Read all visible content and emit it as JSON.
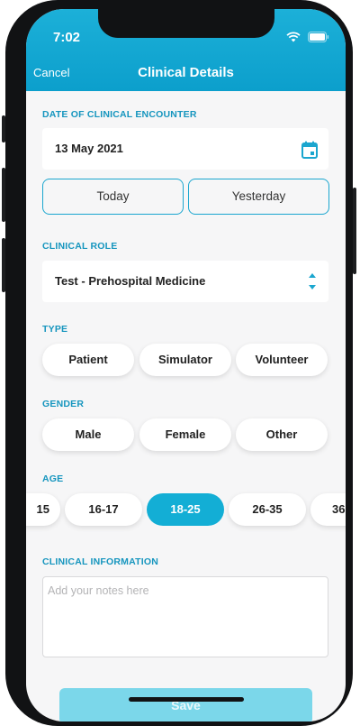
{
  "status_bar": {
    "time": "7:02"
  },
  "header": {
    "cancel_label": "Cancel",
    "title": "Clinical Details"
  },
  "encounter": {
    "label": "DATE OF CLINICAL ENCOUNTER",
    "date": "13 May 2021",
    "today_label": "Today",
    "yesterday_label": "Yesterday"
  },
  "role": {
    "label": "CLINICAL ROLE",
    "value": "Test - Prehospital Medicine"
  },
  "type": {
    "label": "TYPE",
    "options": [
      "Patient",
      "Simulator",
      "Volunteer"
    ]
  },
  "gender": {
    "label": "GENDER",
    "options": [
      "Male",
      "Female",
      "Other"
    ]
  },
  "age": {
    "label": "AGE",
    "options": [
      "15",
      "16-17",
      "18-25",
      "26-35",
      "36"
    ],
    "selected": "18-25"
  },
  "clinical_info": {
    "label": "CLINICAL INFORMATION",
    "placeholder": "Add your notes here"
  },
  "save_label": "Save",
  "colors": {
    "accent": "#13aed5",
    "label": "#1595be",
    "background": "#f6f6f7"
  }
}
